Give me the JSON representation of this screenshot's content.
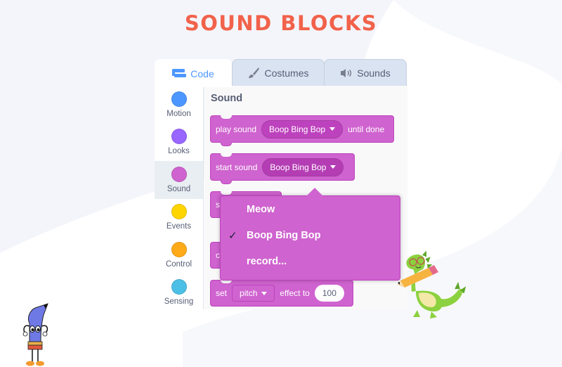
{
  "page": {
    "title": "SOUND BLOCKS"
  },
  "colors": {
    "title": "#f2624b",
    "sound_block": "#cf63cf",
    "active_tab": "#4c97ff"
  },
  "tabs": [
    {
      "label": "Code",
      "icon": "code-blocks-icon",
      "active": true
    },
    {
      "label": "Costumes",
      "icon": "paintbrush-icon",
      "active": false
    },
    {
      "label": "Sounds",
      "icon": "speaker-icon",
      "active": false
    }
  ],
  "categories": [
    {
      "label": "Motion",
      "color": "#4c97ff",
      "active": false
    },
    {
      "label": "Looks",
      "color": "#9966ff",
      "active": false
    },
    {
      "label": "Sound",
      "color": "#cf63cf",
      "active": true
    },
    {
      "label": "Events",
      "color": "#ffd500",
      "active": false
    },
    {
      "label": "Control",
      "color": "#ffab19",
      "active": false
    },
    {
      "label": "Sensing",
      "color": "#4cbfe6",
      "active": false
    }
  ],
  "palette": {
    "title": "Sound",
    "blocks": [
      {
        "prefix": "play sound",
        "menu_value": "Boop Bing Bop",
        "suffix": "until done"
      },
      {
        "prefix": "start sound",
        "menu_value": "Boop Bing Bop"
      },
      {
        "prefix": "s"
      },
      {
        "prefix": "c"
      },
      {
        "prefix": "set",
        "menu_value": "pitch",
        "middle": "effect to",
        "number_value": "100"
      }
    ]
  },
  "dropdown": {
    "items": [
      {
        "label": "Meow",
        "checked": false
      },
      {
        "label": "Boop Bing Bop",
        "checked": true
      },
      {
        "label": "record...",
        "checked": false
      }
    ],
    "check_glyph": "✓"
  }
}
